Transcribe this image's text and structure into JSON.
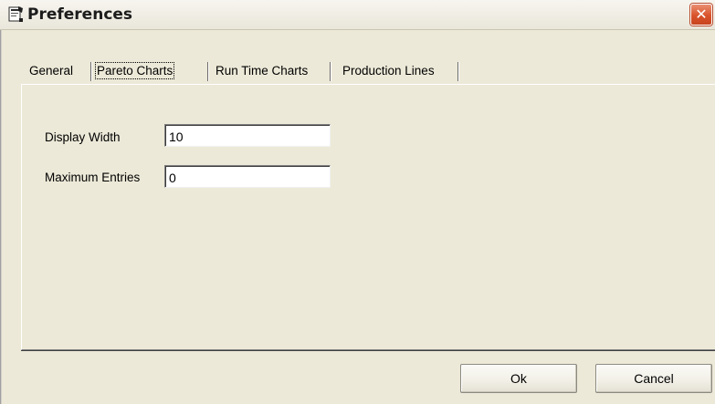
{
  "window": {
    "title": "Preferences",
    "title_icon": "preferences-document-icon",
    "close_glyph": "✕"
  },
  "tabs": [
    {
      "label": "General",
      "active": false
    },
    {
      "label": "Pareto Charts",
      "active": true
    },
    {
      "label": "Run Time Charts",
      "active": false
    },
    {
      "label": "Production Lines",
      "active": false
    }
  ],
  "form": {
    "display_width": {
      "label": "Display Width",
      "value": "10"
    },
    "maximum_entries": {
      "label": "Maximum Entries",
      "value": "0"
    }
  },
  "buttons": {
    "ok_label": "Ok",
    "cancel_label": "Cancel"
  },
  "colors": {
    "dialog_background": "#ece9d8",
    "close_button": "#d9532b"
  }
}
